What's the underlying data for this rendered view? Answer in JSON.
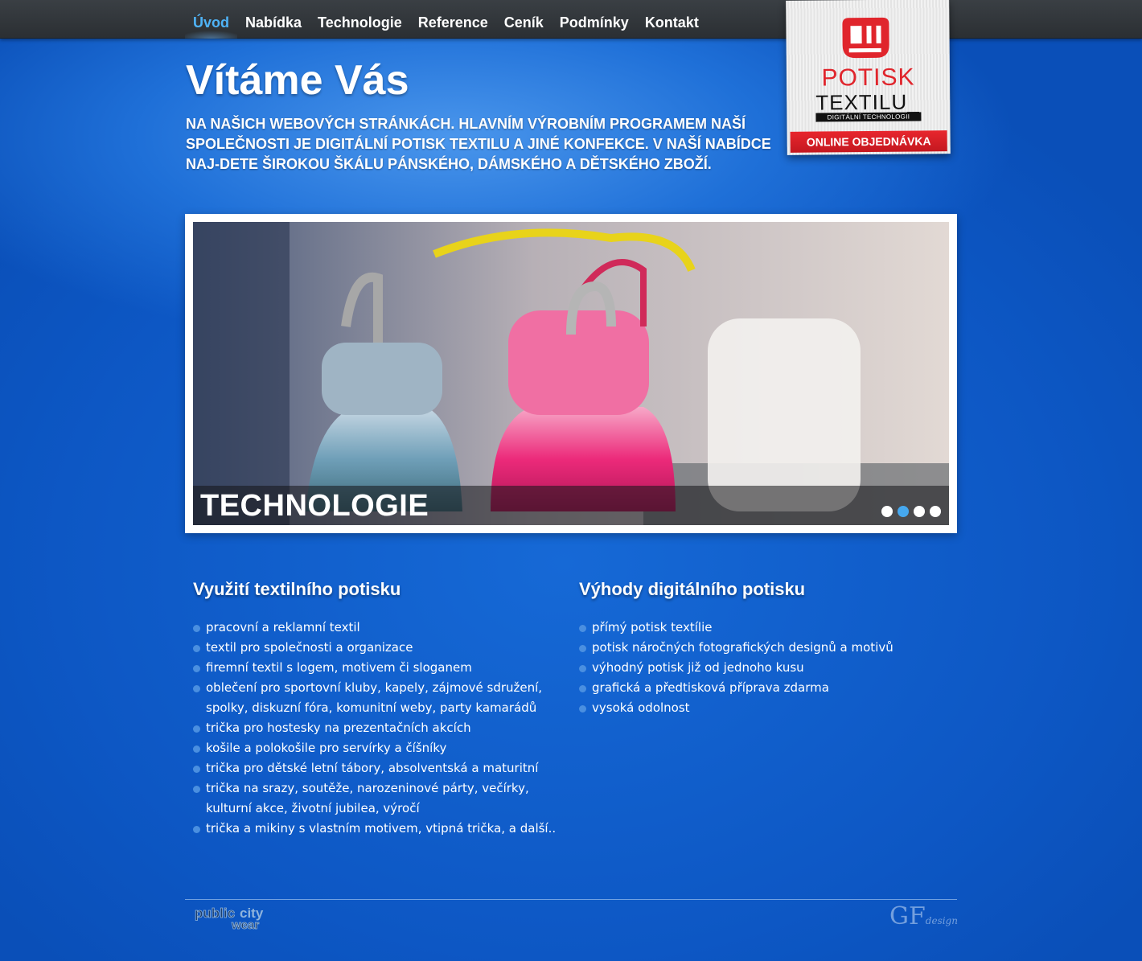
{
  "nav": {
    "items": [
      {
        "label": "Úvod",
        "active": true
      },
      {
        "label": "Nabídka",
        "active": false
      },
      {
        "label": "Technologie",
        "active": false
      },
      {
        "label": "Reference",
        "active": false
      },
      {
        "label": "Ceník",
        "active": false
      },
      {
        "label": "Podmínky",
        "active": false
      },
      {
        "label": "Kontakt",
        "active": false
      }
    ]
  },
  "logo": {
    "potisk": "POTISK",
    "textilu": "TEXTILU_",
    "tagline": "DIGITÁLNÍ TECHNOLOGII",
    "order_label": "ONLINE OBJEDNÁVKA",
    "brand_color": "#e0252c"
  },
  "hero": {
    "title": "Vítáme Vás",
    "subtitle": "NA NAŠICH WEBOVÝCH STRÁNKÁCH. HLAVNÍM VÝROBNÍM PROGRAMEM NAŠÍ SPOLEČNOSTI JE DIGITÁLNÍ POTISK TEXTILU A JINÉ KONFEKCE. V NAŠÍ NABÍDCE NAJ-DETE ŠIROKOU ŠKÁLU PÁNSKÉHO, DÁMSKÉHO A DĚTSKÉHO ZBOŽÍ."
  },
  "slider": {
    "caption": "TECHNOLOGIE",
    "active_index": 1,
    "dot_count": 4,
    "accent_color": "#46a8ef"
  },
  "usage": {
    "title": "Využití textilního potisku",
    "items": [
      "pracovní a reklamní textil",
      "textil pro společnosti a organizace",
      "firemní textil s logem, motivem či sloganem",
      "oblečení pro sportovní kluby, kapely, zájmové sdružení, spolky, diskuzní fóra, komunitní weby, party kamarádů",
      "trička pro hostesky na prezentačních akcích",
      "košile a polokošile pro servírky a číšníky",
      "trička pro dětské letní tábory, absolventská a maturitní",
      "trička na srazy, soutěže, narozeninové párty, večírky, kulturní akce, životní jubilea, výročí",
      "trička a mikiny s vlastním motivem, vtipná trička, a další.."
    ]
  },
  "advantages": {
    "title": "Výhody digitálního potisku",
    "items": [
      "přímý potisk textílie",
      "potisk náročných fotografických designů a motivů",
      "výhodný potisk již od jednoho kusu",
      "grafická a předtisková příprava zdarma",
      "vysoká odolnost"
    ]
  },
  "footer": {
    "left_logo": "publicity wear",
    "right_logo": "GF",
    "right_logo_sub": "design"
  }
}
